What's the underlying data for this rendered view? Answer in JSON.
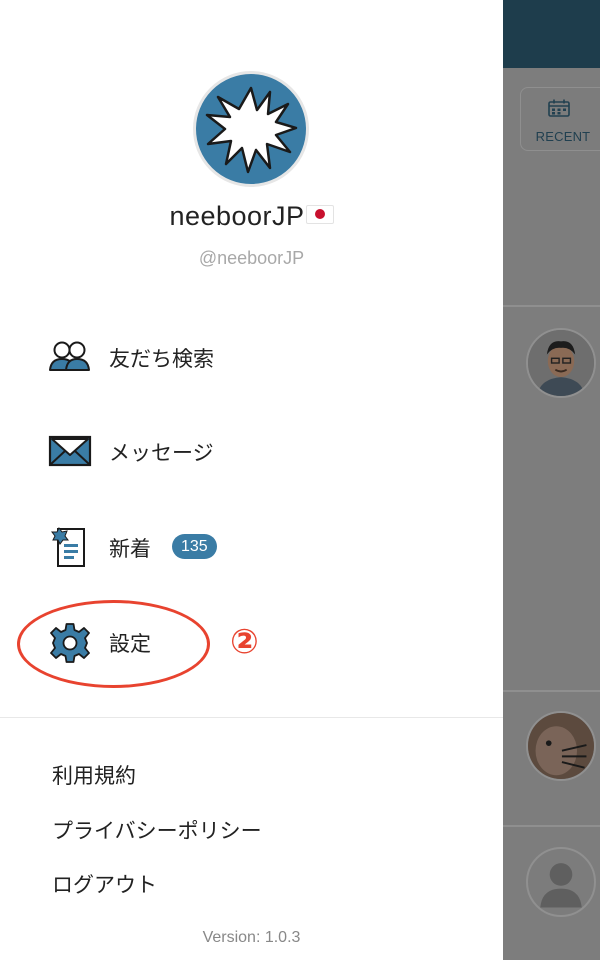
{
  "backdrop": {
    "recent_label": "RECENT"
  },
  "profile": {
    "name": "neeboorJP",
    "handle": "@neeboorJP"
  },
  "menu": {
    "items": [
      {
        "label": "友だち検索",
        "icon": "friends-search-icon"
      },
      {
        "label": "メッセージ",
        "icon": "envelope-icon"
      },
      {
        "label": "新着",
        "icon": "news-icon",
        "badge": "135"
      },
      {
        "label": "設定",
        "icon": "gear-icon"
      }
    ]
  },
  "annotation": {
    "step": "②",
    "color": "#e8432f"
  },
  "footer": {
    "links": [
      "利用規約",
      "プライバシーポリシー",
      "ログアウト"
    ],
    "version": "Version: 1.0.3"
  },
  "colors": {
    "accent": "#3a7ca5",
    "header_dark": "#1e3d4c"
  }
}
